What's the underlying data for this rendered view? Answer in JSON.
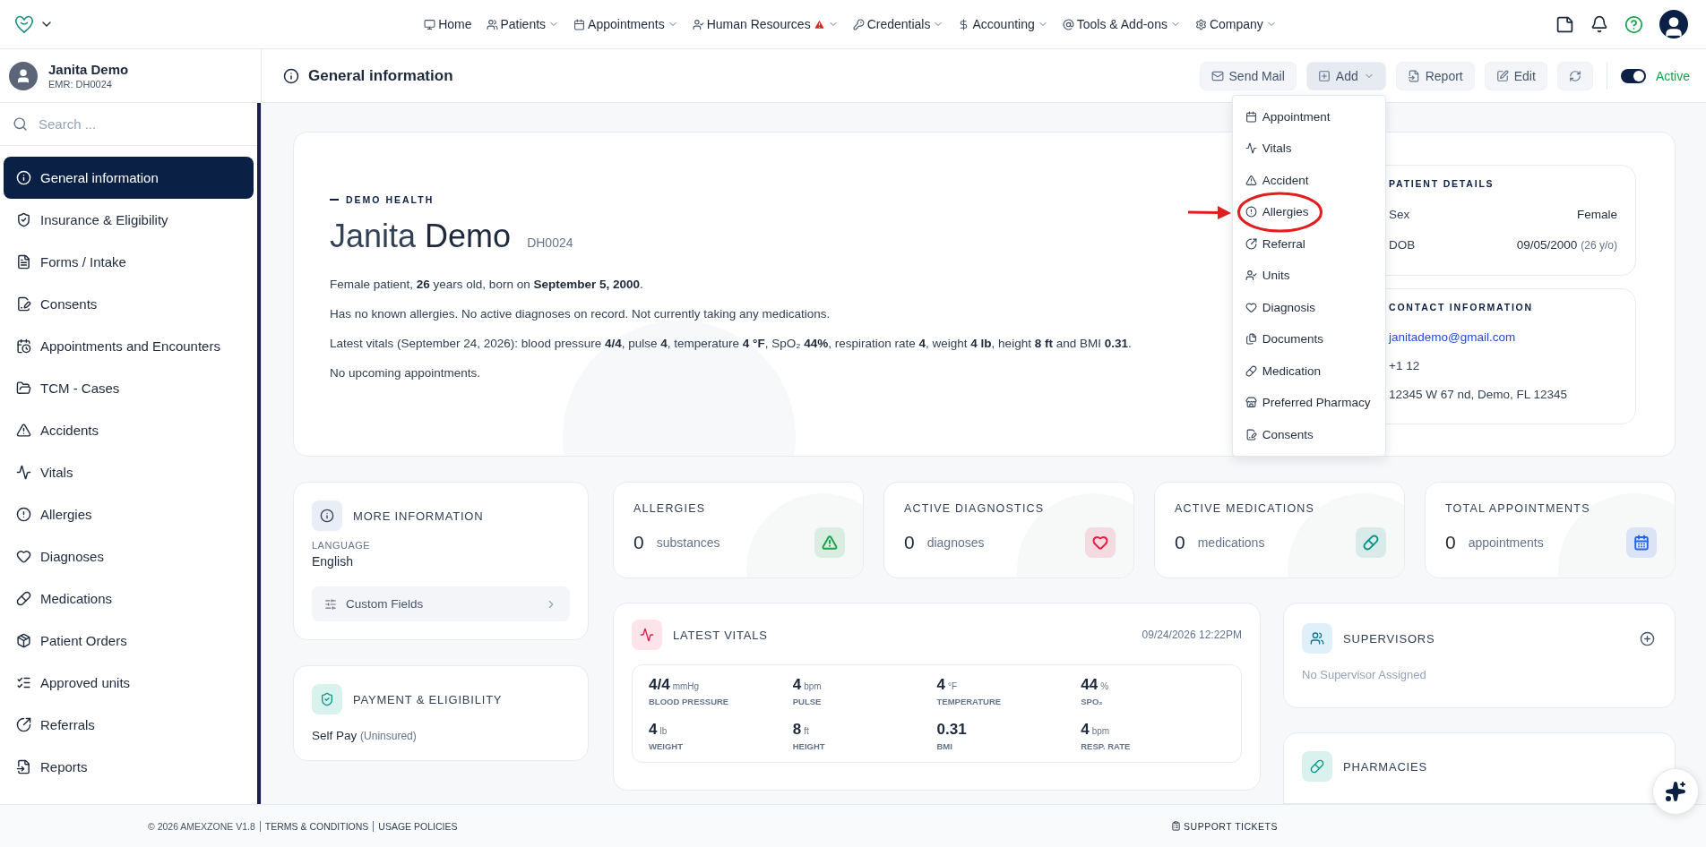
{
  "top_nav": {
    "items": [
      {
        "label": "Home",
        "dropdown": false,
        "alert": false
      },
      {
        "label": "Patients",
        "dropdown": true,
        "alert": false
      },
      {
        "label": "Appointments",
        "dropdown": true,
        "alert": false
      },
      {
        "label": "Human Resources",
        "dropdown": true,
        "alert": true
      },
      {
        "label": "Credentials",
        "dropdown": true,
        "alert": false
      },
      {
        "label": "Accounting",
        "dropdown": true,
        "alert": false
      },
      {
        "label": "Tools & Add-ons",
        "dropdown": true,
        "alert": false
      },
      {
        "label": "Company",
        "dropdown": true,
        "alert": false
      }
    ]
  },
  "patient": {
    "name": "Janita Demo",
    "emr": "EMR: DH0024"
  },
  "sidebar": {
    "search": {
      "placeholder": "Search ..."
    },
    "items": [
      {
        "label": "General information",
        "selected": true
      },
      {
        "label": "Insurance & Eligibility",
        "selected": false
      },
      {
        "label": "Forms / Intake",
        "selected": false
      },
      {
        "label": "Consents",
        "selected": false
      },
      {
        "label": "Appointments and Encounters",
        "selected": false
      },
      {
        "label": "TCM - Cases",
        "selected": false
      },
      {
        "label": "Accidents",
        "selected": false
      },
      {
        "label": "Vitals",
        "selected": false
      },
      {
        "label": "Allergies",
        "selected": false
      },
      {
        "label": "Diagnoses",
        "selected": false
      },
      {
        "label": "Medications",
        "selected": false
      },
      {
        "label": "Patient Orders",
        "selected": false
      },
      {
        "label": "Approved units",
        "selected": false
      },
      {
        "label": "Referrals",
        "selected": false
      },
      {
        "label": "Reports",
        "selected": false
      }
    ]
  },
  "page_header": {
    "title": "General information",
    "actions": [
      {
        "label": "Send Mail",
        "expanded": false
      },
      {
        "label": "Add",
        "expanded": true
      },
      {
        "label": "Report",
        "expanded": false
      },
      {
        "label": "Edit",
        "expanded": false
      }
    ],
    "status": {
      "label": "Active",
      "on": true
    }
  },
  "add_menu": {
    "items": [
      {
        "label": "Appointment",
        "highlighted": false
      },
      {
        "label": "Vitals",
        "highlighted": false
      },
      {
        "label": "Accident",
        "highlighted": false
      },
      {
        "label": "Allergies",
        "highlighted": true
      },
      {
        "label": "Referral",
        "highlighted": false
      },
      {
        "label": "Units",
        "highlighted": false
      },
      {
        "label": "Diagnosis",
        "highlighted": false
      },
      {
        "label": "Documents",
        "highlighted": false
      },
      {
        "label": "Medication",
        "highlighted": false
      },
      {
        "label": "Preferred Pharmacy",
        "highlighted": false
      },
      {
        "label": "Consents",
        "highlighted": false
      }
    ]
  },
  "hero": {
    "eyebrow": "DEMO HEALTH",
    "first_name": "Janita",
    "last_name": "Demo",
    "id": "DH0024",
    "paragraphs": [
      "Female patient, **26** years old, born on **September 5, 2000**.",
      "Has no known allergies. No active diagnoses on record. Not currently taking any medications.",
      "Latest vitals (September 24, 2026): blood pressure **4/4**, pulse **4**, temperature **4 °F**, SpO₂ **44%**, respiration rate **4**, weight **4 lb**, height **8 ft** and BMI **0.31**.",
      "No upcoming appointments."
    ]
  },
  "patient_details": {
    "title": "PATIENT DETAILS",
    "rows": [
      {
        "label": "Sex",
        "value": "Female"
      },
      {
        "label": "DOB",
        "value": "09/05/2000",
        "note": "(26 y/o)"
      }
    ]
  },
  "contact_information": {
    "title": "CONTACT INFORMATION",
    "email": "janitademo@gmail.com",
    "phone": "+1 12",
    "address": "12345 W 67 nd, Demo, FL 12345"
  },
  "more_information": {
    "title": "MORE INFORMATION",
    "language_label": "LANGUAGE",
    "language": "English",
    "custom_fields": "Custom Fields"
  },
  "payment": {
    "title": "PAYMENT & ELIGIBILITY",
    "value": "Self Pay",
    "note": "(Uninsured)"
  },
  "stats": [
    {
      "title": "ALLERGIES",
      "count": "0",
      "unit": "substances",
      "color": "#16a34a"
    },
    {
      "title": "ACTIVE DIAGNOSTICS",
      "count": "0",
      "unit": "diagnoses",
      "color": "#e11d48"
    },
    {
      "title": "ACTIVE MEDICATIONS",
      "count": "0",
      "unit": "medications",
      "color": "#0d9488"
    },
    {
      "title": "TOTAL APPOINTMENTS",
      "count": "0",
      "unit": "appointments",
      "color": "#2563eb"
    }
  ],
  "latest_vitals": {
    "title": "LATEST VITALS",
    "timestamp": "09/24/2026 12:22PM",
    "items": [
      {
        "value": "4/4",
        "unit": "mmHg",
        "label": "BLOOD PRESSURE"
      },
      {
        "value": "4",
        "unit": "bpm",
        "label": "PULSE"
      },
      {
        "value": "4",
        "unit": "°F",
        "label": "TEMPERATURE"
      },
      {
        "value": "44",
        "unit": "%",
        "label": "SPO₂"
      },
      {
        "value": "4",
        "unit": "lb",
        "label": "WEIGHT"
      },
      {
        "value": "8",
        "unit": "ft",
        "label": "HEIGHT"
      },
      {
        "value": "0.31",
        "label": "BMI"
      },
      {
        "value": "4",
        "unit": "bpm",
        "label": "RESP. RATE"
      }
    ]
  },
  "supervisors": {
    "title": "SUPERVISORS",
    "empty": "No Supervisor Assigned"
  },
  "pharmacies": {
    "title": "PHARMACIES"
  },
  "footer": {
    "copyright": "© 2026 AMEXZONE V1.8",
    "links": [
      "TERMS & CONDITIONS",
      "USAGE POLICIES"
    ],
    "support": "SUPPORT TICKETS"
  }
}
